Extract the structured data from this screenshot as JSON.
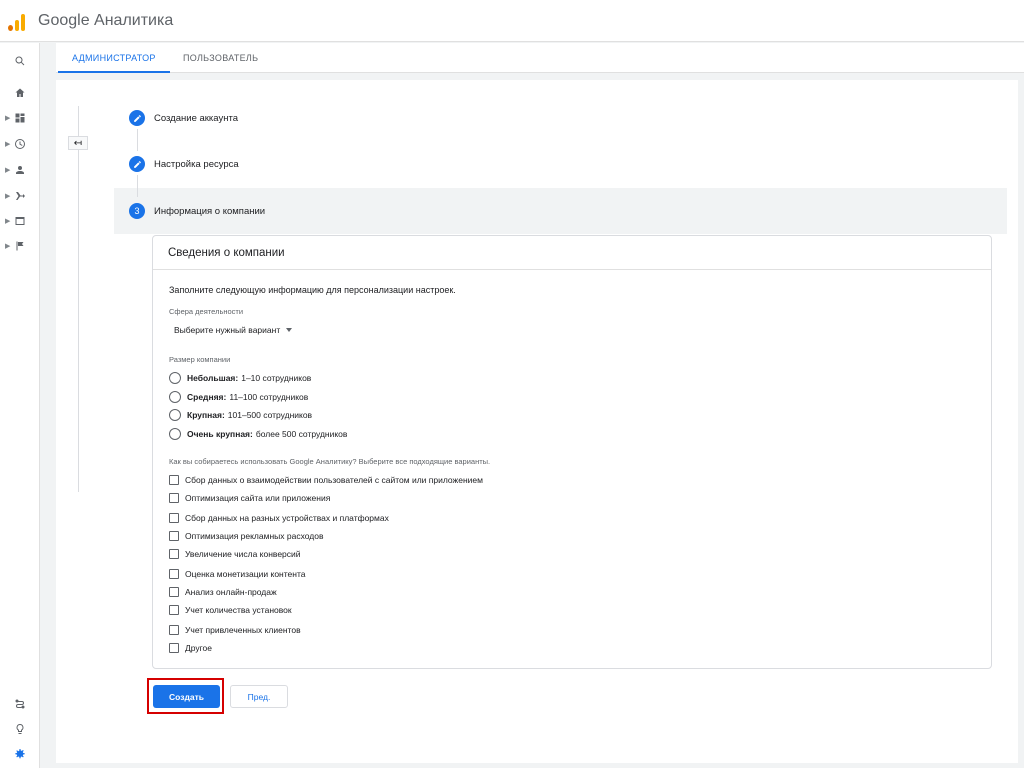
{
  "app": {
    "title": "Google Аналитика"
  },
  "tabs": [
    {
      "label": "АДМИНИСТРАТОР",
      "active": true
    },
    {
      "label": "ПОЛЬЗОВАТЕЛЬ",
      "active": false
    }
  ],
  "nav_icons": [
    "search-icon",
    "home-icon",
    "dashboard-icon",
    "clock-icon",
    "person-icon",
    "fork-icon",
    "display-icon",
    "flag-icon",
    "route-icon",
    "lightbulb-icon",
    "gear-icon"
  ],
  "back_icon": "↤",
  "steps": [
    {
      "label": "Создание аккаунта",
      "icon": "pencil-icon"
    },
    {
      "label": "Настройка ресурса",
      "icon": "pencil-icon"
    },
    {
      "label": "Информация о компании",
      "number": "3"
    }
  ],
  "card": {
    "title": "Сведения о компании",
    "intro": "Заполните следующую информацию для персонализации настроек.",
    "industry": {
      "label": "Сфера деятельности",
      "value": "Выберите нужный вариант"
    },
    "size": {
      "label": "Размер компании",
      "options": [
        {
          "bold": "Небольшая:",
          "text": "1–10 сотрудников"
        },
        {
          "bold": "Средняя:",
          "text": "11–100 сотрудников"
        },
        {
          "bold": "Крупная:",
          "text": "101–500 сотрудников"
        },
        {
          "bold": "Очень крупная:",
          "text": "более 500 сотрудников"
        }
      ]
    },
    "usage": {
      "label": "Как вы собираетесь использовать Google Аналитику? Выберите все подходящие варианты.",
      "options": [
        "Сбор данных о взаимодействии пользователей с сайтом или приложением",
        "Оптимизация сайта или приложения",
        "Сбор данных на разных устройствах и платформах",
        "Оптимизация рекламных расходов",
        "Увеличение числа конверсий",
        "Оценка монетизации контента",
        "Анализ онлайн-продаж",
        "Учет количества установок",
        "Учет привлеченных клиентов",
        "Другое"
      ]
    }
  },
  "buttons": {
    "create": "Создать",
    "prev": "Пред."
  },
  "colors": {
    "accent": "#1a73e8",
    "highlight": "#d50000",
    "logo": "#f9ab00"
  }
}
